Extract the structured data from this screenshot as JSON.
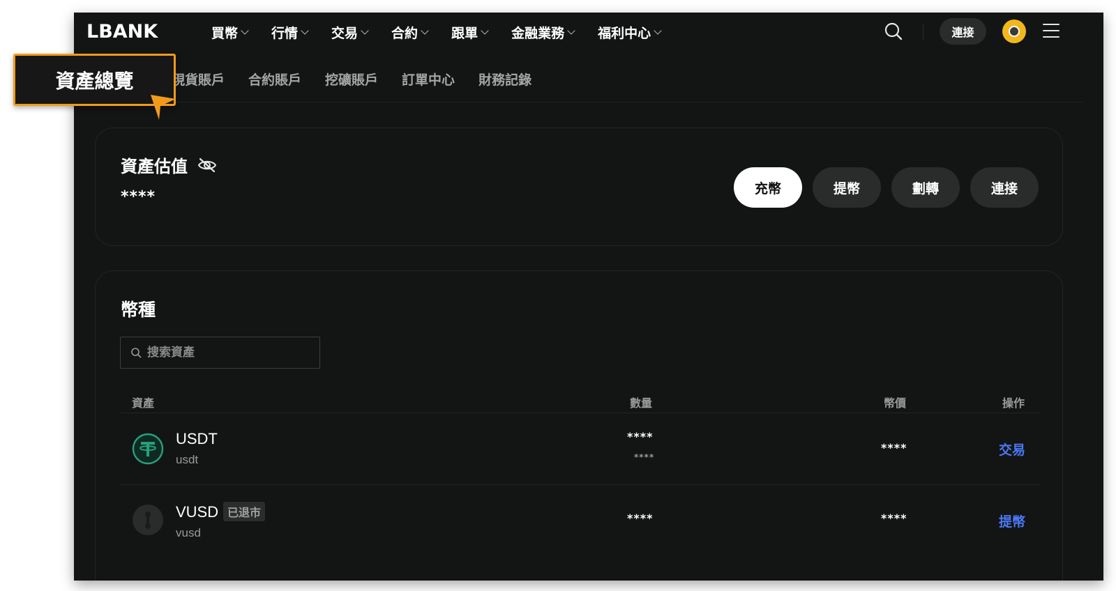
{
  "brand": {
    "logo": "LBANK"
  },
  "nav": {
    "items": [
      "買幣",
      "行情",
      "交易",
      "合約",
      "跟單",
      "金融業務",
      "福利中心"
    ],
    "connect_label": "連接"
  },
  "subtabs": [
    "現貨賬戶",
    "合約賬戶",
    "挖礦賬戶",
    "訂單中心",
    "財務記錄"
  ],
  "callout": {
    "label": "資產總覽"
  },
  "valuation": {
    "title": "資產估值",
    "amount": "****",
    "actions": [
      "充幣",
      "提幣",
      "劃轉",
      "連接"
    ]
  },
  "coins": {
    "title": "幣種",
    "search_placeholder": "搜索資產",
    "columns": [
      "資產",
      "數量",
      "幣價",
      "操作"
    ],
    "rows": [
      {
        "symbol": "USDT",
        "name": "usdt",
        "badge": "",
        "quantity": "****",
        "quantity_sub": "****",
        "price": "****",
        "action": "交易"
      },
      {
        "symbol": "VUSD",
        "name": "vusd",
        "badge": "已退市",
        "quantity": "****",
        "quantity_sub": "",
        "price": "****",
        "action": "提幣"
      }
    ]
  },
  "colors": {
    "background": "#131414",
    "accent_link": "#4a79f5",
    "callout_border": "#f29a1b",
    "usdt_green": "#26a17b"
  }
}
